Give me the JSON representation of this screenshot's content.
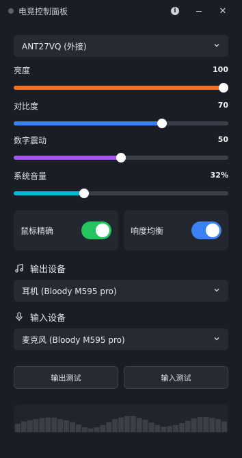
{
  "window": {
    "title": "电竞控制面板"
  },
  "monitor": {
    "selected": "ANT27VQ (外接)"
  },
  "sliders": [
    {
      "label": "亮度",
      "value_text": "100",
      "value": 100,
      "color": "#f37021"
    },
    {
      "label": "对比度",
      "value_text": "70",
      "value": 70,
      "color": "#3b82f6"
    },
    {
      "label": "数字震动",
      "value_text": "50",
      "value": 50,
      "color": "#a855f7"
    },
    {
      "label": "系统音量",
      "value_text": "32%",
      "value": 32,
      "color": "#06b6d4"
    }
  ],
  "toggles": [
    {
      "label": "鼠标精确",
      "on": true,
      "color": "#22c55e"
    },
    {
      "label": "响度均衡",
      "on": true,
      "color": "#3b82f6"
    }
  ],
  "output": {
    "heading": "输出设备",
    "icon": "music-note-icon",
    "selected": "耳机 (Bloody M595 pro)"
  },
  "input": {
    "heading": "输入设备",
    "icon": "microphone-icon",
    "selected": "麦克风 (Bloody M595 pro)"
  },
  "buttons": {
    "output_test": "输出测试",
    "input_test": "输入测试"
  },
  "visualizer": {
    "levels": [
      0.35,
      0.45,
      0.5,
      0.55,
      0.6,
      0.62,
      0.62,
      0.55,
      0.5,
      0.42,
      0.32,
      0.2,
      0.15,
      0.2,
      0.3,
      0.42,
      0.55,
      0.62,
      0.68,
      0.68,
      0.6,
      0.52,
      0.4,
      0.3,
      0.22,
      0.25,
      0.3,
      0.38,
      0.48,
      0.58,
      0.65,
      0.65,
      0.6,
      0.55,
      0.45
    ]
  }
}
